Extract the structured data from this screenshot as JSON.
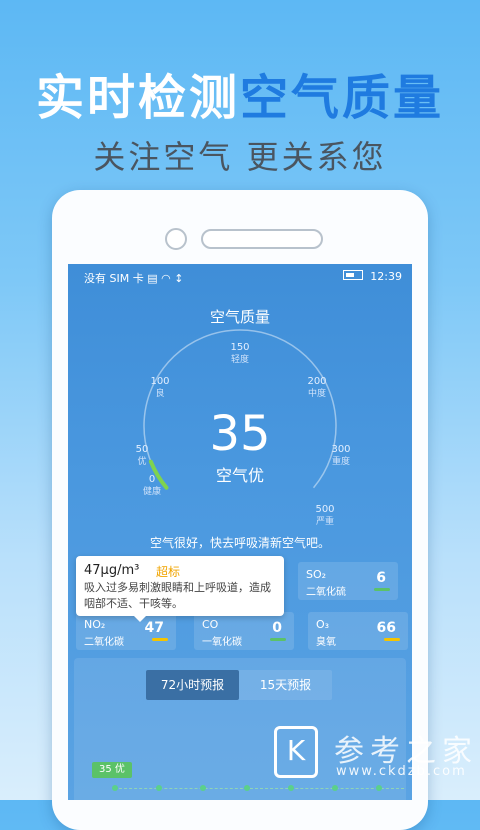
{
  "promo": {
    "headline_white": "实时检测",
    "headline_blue": "空气质量",
    "subline": "关注空气  更关系您"
  },
  "status_bar": {
    "left": "没有 SIM 卡",
    "time": "12:39"
  },
  "screen": {
    "title": "空气质量",
    "aqi_value": "35",
    "aqi_level": "空气优",
    "aqi_fraction": 0.07,
    "message": "空气很好，快去呼吸清新空气吧。"
  },
  "gauge_ticks": [
    {
      "value": "0",
      "desc": "健康"
    },
    {
      "value": "50",
      "desc": "优"
    },
    {
      "value": "100",
      "desc": "良"
    },
    {
      "value": "150",
      "desc": "轻度"
    },
    {
      "value": "200",
      "desc": "中度"
    },
    {
      "value": "300",
      "desc": "重度"
    },
    {
      "value": "500",
      "desc": "严重"
    }
  ],
  "pollutants": [
    {
      "formula": "SO₂",
      "name": "二氧化硫",
      "value": "6",
      "color": "#5bc268"
    },
    {
      "formula": "NO₂",
      "name": "二氧化碳",
      "value": "47",
      "color": "#f5c400"
    },
    {
      "formula": "CO",
      "name": "一氧化碳",
      "value": "0",
      "color": "#5bc268"
    },
    {
      "formula": "O₃",
      "name": "臭氧",
      "value": "66",
      "color": "#f5c400"
    }
  ],
  "tooltip": {
    "value": "47μg/m³",
    "tag": "超标",
    "description": "吸入过多易刺激眼睛和上呼吸道，造成咽部不适、干咳等。"
  },
  "forecast": {
    "tabs": [
      "72小时预报",
      "15天预报"
    ],
    "active_tab": 0,
    "first_point_label": "35 优"
  },
  "watermark": {
    "logo_letter": "K",
    "text": "参考之家",
    "url": "www.ckdzb.com"
  },
  "colors": {
    "accent_blue": "#1f7be0",
    "good_green": "#5bc268",
    "warn_yellow": "#f5c400"
  }
}
